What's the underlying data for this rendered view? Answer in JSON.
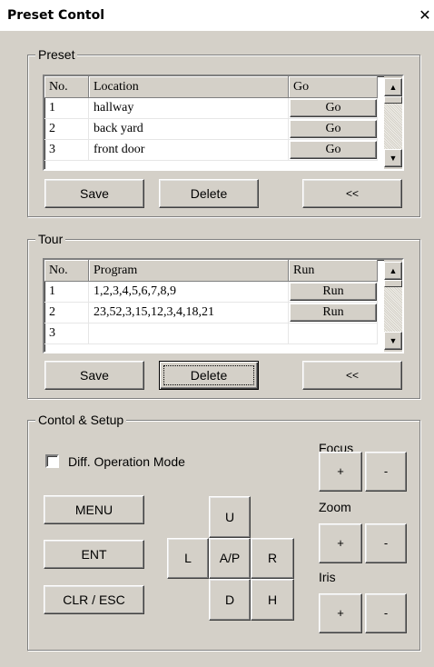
{
  "window": {
    "title": "Preset Contol",
    "close_symbol": "✕"
  },
  "preset": {
    "group_title": "Preset",
    "columns": [
      "No.",
      "Location",
      "Go"
    ],
    "rows": [
      {
        "no": "1",
        "location": "hallway",
        "action": "Go"
      },
      {
        "no": "2",
        "location": "back yard",
        "action": "Go"
      },
      {
        "no": "3",
        "location": "front door",
        "action": "Go"
      }
    ],
    "save_label": "Save",
    "delete_label": "Delete",
    "collapse_label": "<<"
  },
  "tour": {
    "group_title": "Tour",
    "columns": [
      "No.",
      "Program",
      "Run"
    ],
    "rows": [
      {
        "no": "1",
        "program": "1,2,3,4,5,6,7,8,9",
        "action": "Run"
      },
      {
        "no": "2",
        "program": "23,52,3,15,12,3,4,18,21",
        "action": "Run"
      },
      {
        "no": "3",
        "program": "",
        "action": ""
      }
    ],
    "save_label": "Save",
    "delete_label": "Delete",
    "collapse_label": "<<"
  },
  "control": {
    "group_title": "Contol & Setup",
    "diff_mode_label": "Diff. Operation Mode",
    "diff_mode_checked": false,
    "menu_label": "MENU",
    "ent_label": "ENT",
    "clr_esc_label": "CLR / ESC",
    "pad": {
      "up": "U",
      "left": "L",
      "center": "A/P",
      "right": "R",
      "down": "D",
      "home": "H"
    },
    "focus": {
      "label": "Focus",
      "plus": "+",
      "minus": "-"
    },
    "zoom": {
      "label": "Zoom",
      "plus": "+",
      "minus": "-"
    },
    "iris": {
      "label": "Iris",
      "plus": "+",
      "minus": "-"
    }
  },
  "icons": {
    "scroll_up": "▲",
    "scroll_down": "▼"
  }
}
